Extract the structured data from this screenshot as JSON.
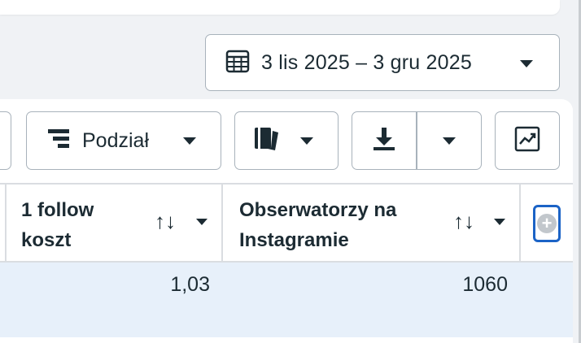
{
  "date_range": {
    "label": "3 lis 2025 – 3 gru 2025",
    "icon": "calendar-icon"
  },
  "toolbar": {
    "breakdown_label": "Podział",
    "breakdown_icon": "breakdown-icon",
    "reports_icon": "reports-icon",
    "export_icon": "download-icon",
    "chart_icon": "trend-chart-icon"
  },
  "table": {
    "columns": [
      {
        "line1": "1 follow",
        "line2": "koszt"
      },
      {
        "line1": "Obserwatorzy na",
        "line2": "Instagramie"
      }
    ],
    "sort_glyph": "↑↓",
    "rows": [
      {
        "cost": "1,03",
        "followers": "1060"
      }
    ],
    "add_column_glyph": "+"
  },
  "colors": {
    "accent": "#1b63c6",
    "row_highlight": "#e7f0fa",
    "border": "#a8b2bb"
  }
}
